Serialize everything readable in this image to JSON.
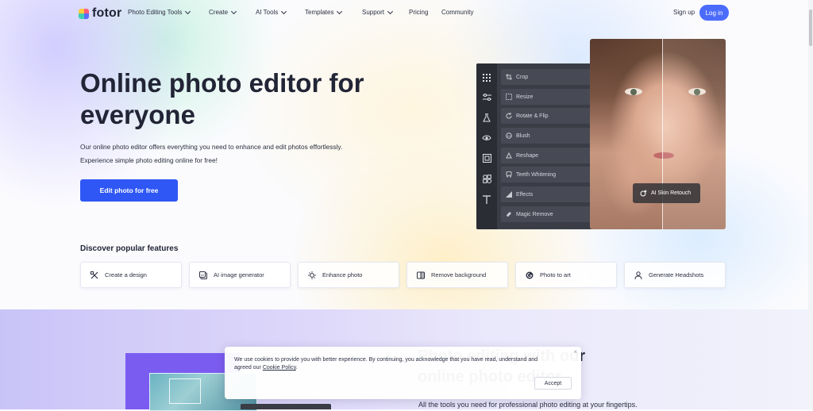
{
  "nav": {
    "brand": "fotor",
    "items": [
      {
        "label": "Photo Editing Tools",
        "dropdown": true
      },
      {
        "label": "Create",
        "dropdown": true
      },
      {
        "label": "AI Tools",
        "dropdown": true
      },
      {
        "label": "Templates",
        "dropdown": true
      },
      {
        "label": "Support",
        "dropdown": true
      },
      {
        "label": "Pricing",
        "dropdown": false
      },
      {
        "label": "Community",
        "dropdown": false
      }
    ],
    "signup": "Sign up",
    "login": "Log in"
  },
  "hero": {
    "title_line1": "Online photo editor for",
    "title_line2": "everyone",
    "desc_line1": "Our online photo editor offers everything you need to enhance and edit photos effortlessly.",
    "desc_line2": "Experience simple photo editing online for free!",
    "cta": "Edit photo for free"
  },
  "editor": {
    "rail_icons": [
      "grid-icon",
      "sliders-icon",
      "flask-icon",
      "eye-icon",
      "frame-icon",
      "shapes-icon",
      "text-icon"
    ],
    "menu": [
      {
        "label": "Crop",
        "icon": "crop-icon"
      },
      {
        "label": "Resize",
        "icon": "resize-icon"
      },
      {
        "label": "Rotate & Flip",
        "icon": "rotate-icon"
      },
      {
        "label": "Blush",
        "icon": "blush-icon"
      },
      {
        "label": "Reshape",
        "icon": "reshape-icon"
      },
      {
        "label": "Teeth Whitening",
        "icon": "tooth-icon"
      },
      {
        "label": "Effects",
        "icon": "effects-icon"
      },
      {
        "label": "Magic Remove",
        "icon": "eraser-icon"
      }
    ],
    "retouch_label": "AI Skin Retouch"
  },
  "features": {
    "title": "Discover popular features",
    "items": [
      {
        "label": "Create a design",
        "icon": "design-icon"
      },
      {
        "label": "AI image generator",
        "icon": "ai-image-icon"
      },
      {
        "label": "Enhance photo",
        "icon": "enhance-icon"
      },
      {
        "label": "Remove background",
        "icon": "remove-bg-icon"
      },
      {
        "label": "Photo to art",
        "icon": "art-icon"
      },
      {
        "label": "Generate Headshots",
        "icon": "headshot-icon"
      }
    ]
  },
  "section": {
    "title_line1": "Photo editing with our",
    "title_line2": "online photo editor",
    "subtitle": "All the tools you need for professional photo editing at your fingertips."
  },
  "cookie": {
    "text_line1": "We use cookies to provide you with better experience. By continuing, you acknowledge that you have read, understand and",
    "text_prefix": "agreed our ",
    "link": "Cookie Policy",
    "text_suffix": ".",
    "accept": "Accept",
    "close": "×"
  }
}
